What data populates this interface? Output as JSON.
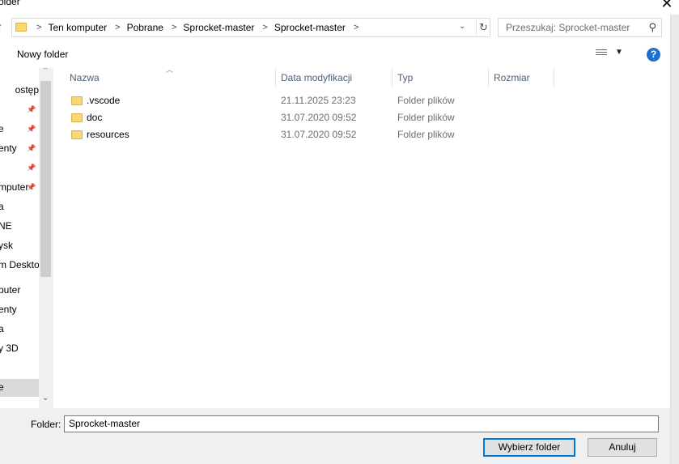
{
  "window": {
    "title": "older",
    "close_glyph": "✕"
  },
  "address": {
    "crumbs": [
      "Ten komputer",
      "Pobrane",
      "Sprocket-master",
      "Sprocket-master"
    ],
    "search_placeholder": "Przeszukaj: Sprocket-master"
  },
  "toolbar": {
    "new_folder": "Nowy folder",
    "help": "?"
  },
  "nav": {
    "items": [
      {
        "label": "ostęp",
        "pinned": false
      },
      {
        "label": "",
        "pinned": true
      },
      {
        "label": "e",
        "pinned": true
      },
      {
        "label": "enty",
        "pinned": true
      },
      {
        "label": "",
        "pinned": true
      },
      {
        "label": "mputer",
        "pinned": true
      },
      {
        "label": "a",
        "pinned": false
      },
      {
        "label": "NE",
        "pinned": false
      },
      {
        "label": "ysk",
        "pinned": false
      },
      {
        "label": "m Deskto",
        "pinned": false
      },
      {
        "label": "puter",
        "pinned": false
      },
      {
        "label": "enty",
        "pinned": false
      },
      {
        "label": "a",
        "pinned": false
      },
      {
        "label": "y 3D",
        "pinned": false
      },
      {
        "label": "e",
        "pinned": false,
        "selected": true
      }
    ]
  },
  "columns": {
    "name": "Nazwa",
    "date": "Data modyfikacji",
    "type": "Typ",
    "size": "Rozmiar"
  },
  "files": [
    {
      "name": ".vscode",
      "date": "21.11.2025 23:23",
      "type": "Folder plików"
    },
    {
      "name": "doc",
      "date": "31.07.2020 09:52",
      "type": "Folder plików"
    },
    {
      "name": "resources",
      "date": "31.07.2020 09:52",
      "type": "Folder plików"
    }
  ],
  "footer": {
    "folder_label": "Folder:",
    "folder_value": "Sprocket-master",
    "select_button": "Wybierz folder",
    "cancel_button": "Anuluj"
  },
  "colors": {
    "accent": "#0078d7",
    "folder": "#f8d775",
    "header_text": "#4c607a"
  }
}
